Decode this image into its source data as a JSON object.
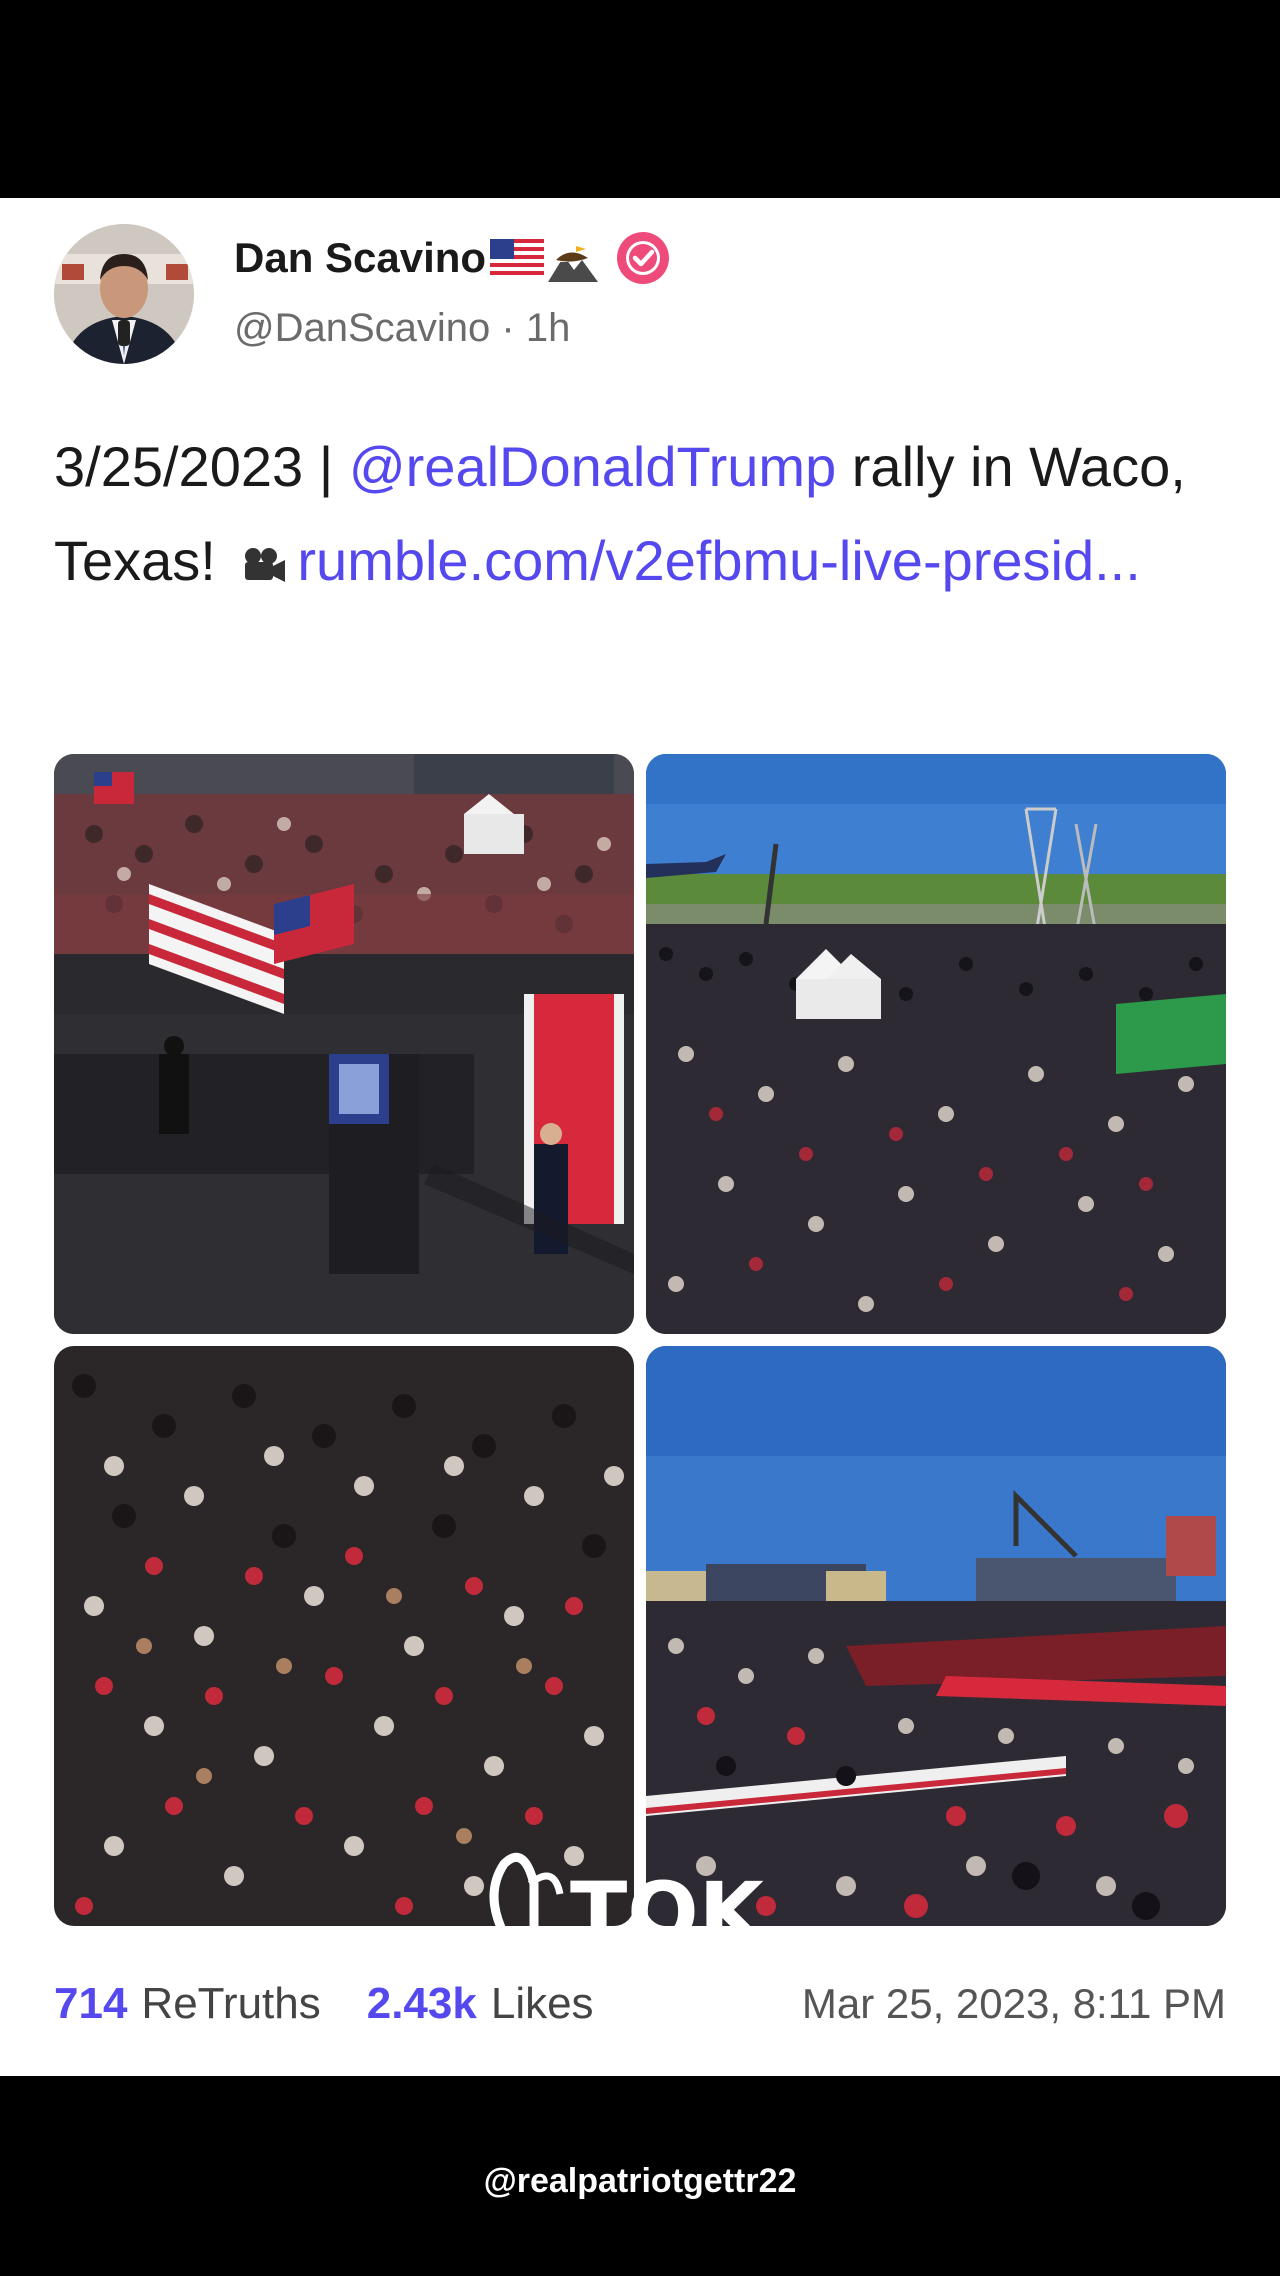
{
  "post": {
    "author": {
      "display_name": "Dan Scavino",
      "handle_time": "@DanScavino · 1h"
    },
    "text": {
      "date": "3/25/2023",
      "separator": "|",
      "mention": "@realDonaldTrump",
      "body_1": " rally in Waco, Texas! ",
      "link": "rumble.com/v2efbmu-live-presid..."
    },
    "stats": {
      "retruths_count": "714",
      "retruths_label": "ReTruths",
      "likes_count": "2.43k",
      "likes_label": "Likes",
      "timestamp": "Mar 25, 2023, 8:11 PM"
    }
  },
  "watermark": {
    "logo_text": "TOK",
    "handle": "@realpatriotgettr22"
  },
  "colors": {
    "accent": "#5448ee",
    "verified": "#ee4b7a"
  }
}
